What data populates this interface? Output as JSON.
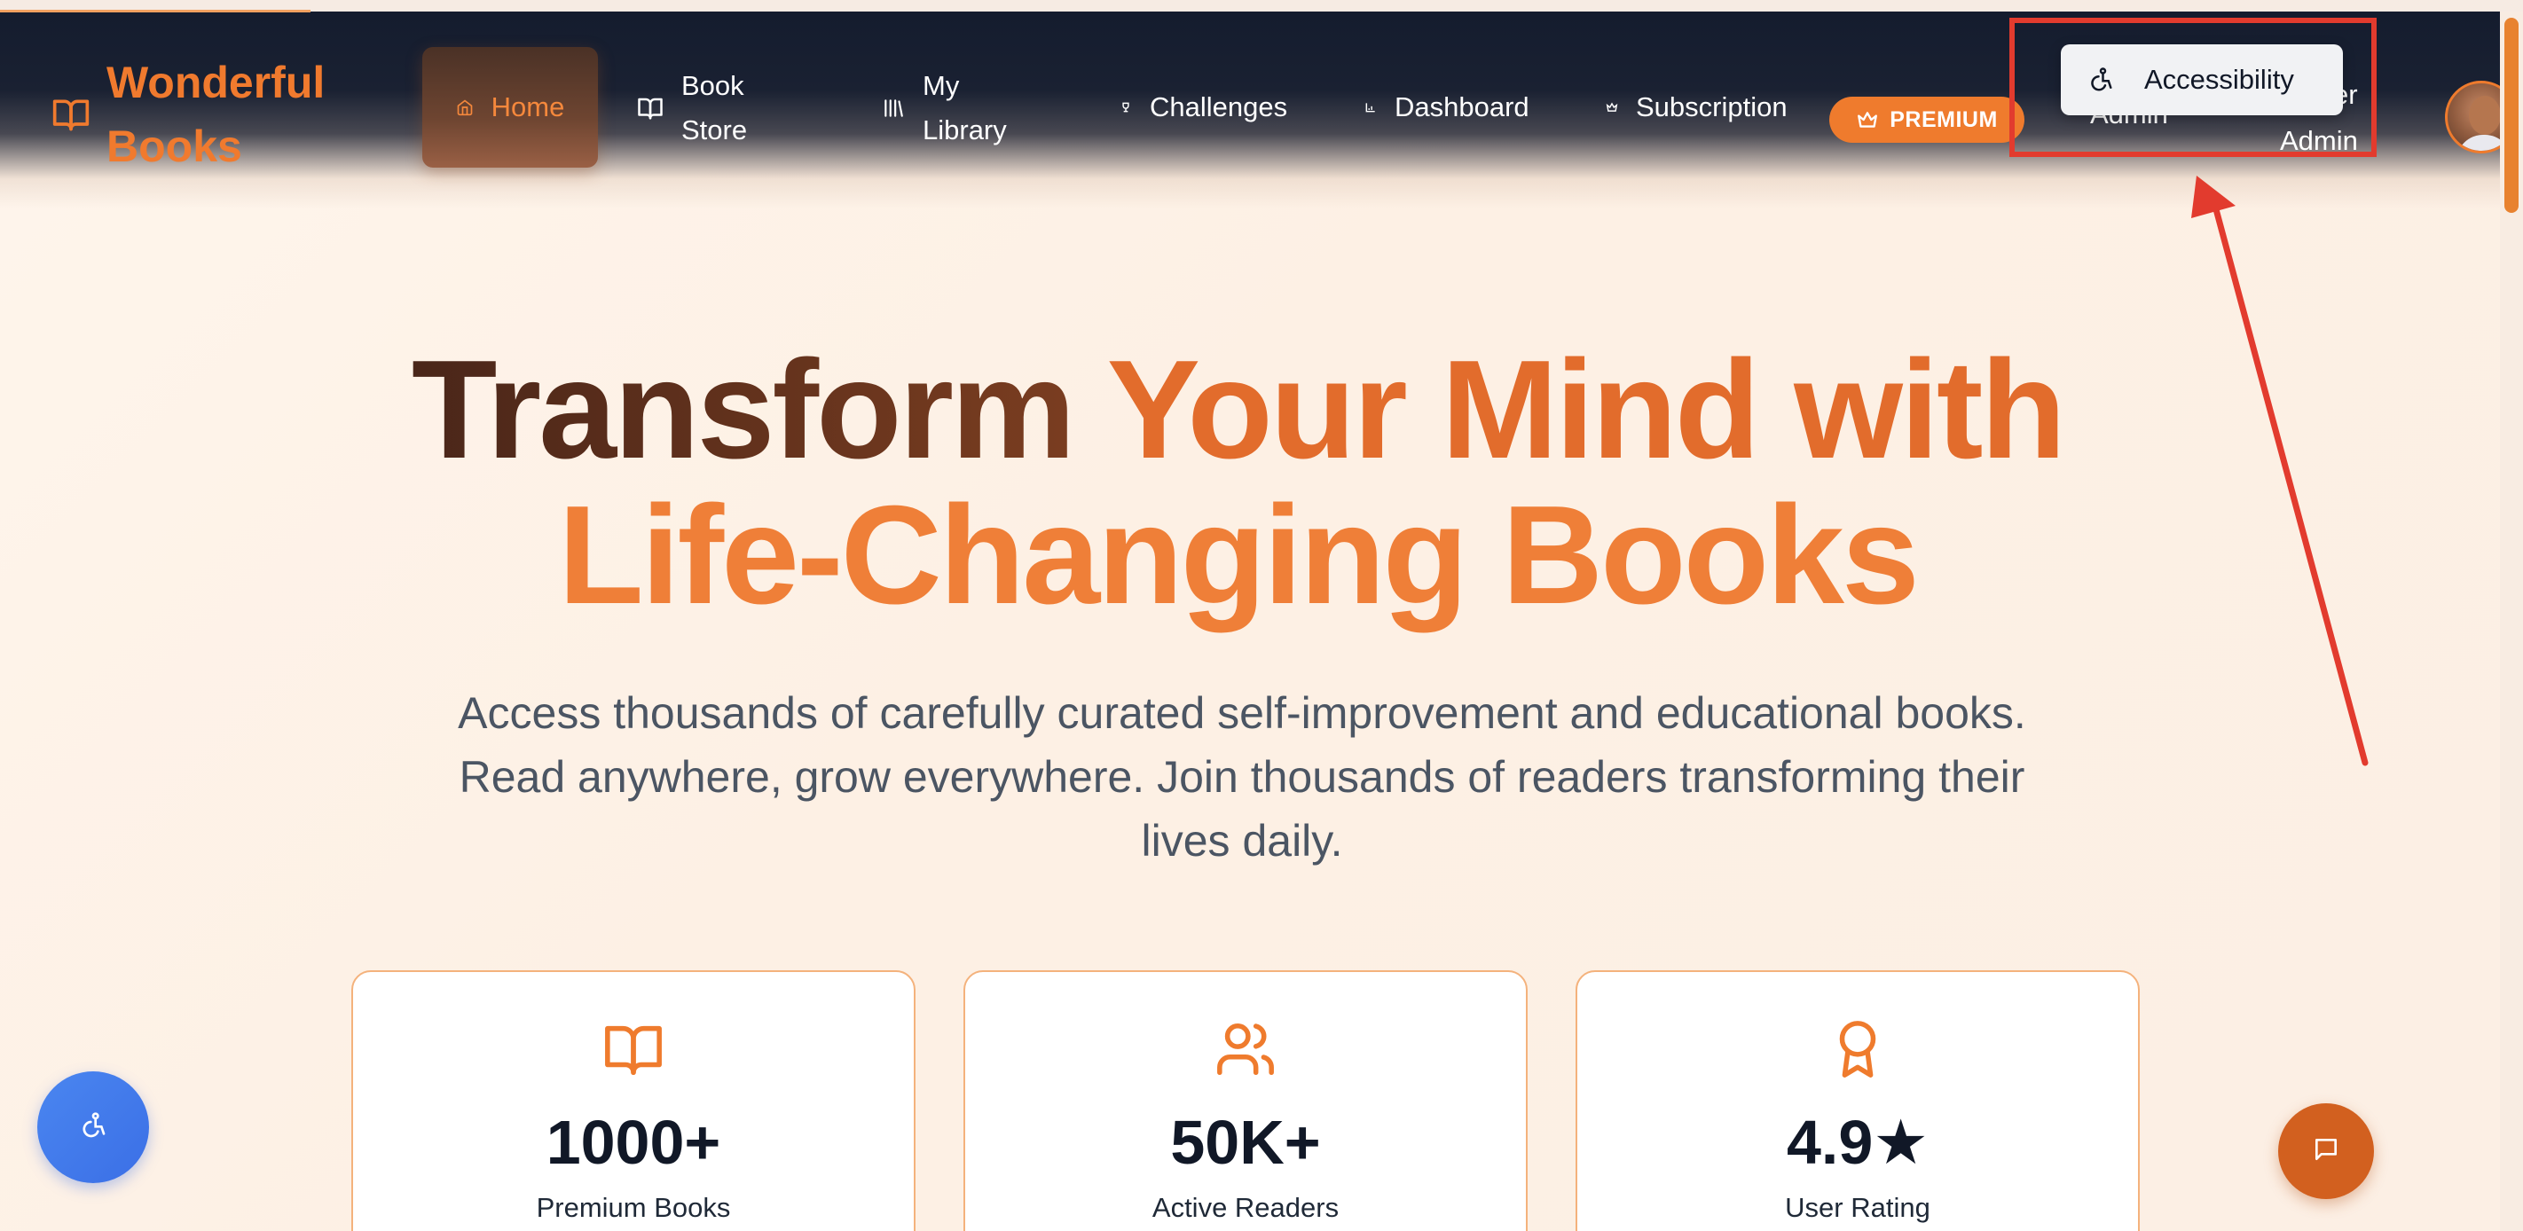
{
  "brand": {
    "name_line1": "Wonderful",
    "name_line2": "Books",
    "icon": "book-open-icon"
  },
  "nav": {
    "home": "Home",
    "book_store_1": "Book",
    "book_store_2": "Store",
    "my_library_1": "My",
    "my_library_2": "Library",
    "challenges": "Challenges",
    "dashboard": "Dashboard",
    "subscription": "Subscription",
    "premium": "PREMIUM"
  },
  "user": {
    "left_fragment": "Admin",
    "right_fragment": "er",
    "name": "Admin"
  },
  "tooltip": {
    "label": "Accessibility",
    "icon": "accessibility-icon"
  },
  "hero": {
    "title_part1": "Transform",
    "title_part2": "Your Mind with",
    "title_line2": "Life-Changing Books",
    "subtitle": "Access thousands of carefully curated self-improvement and educational books. Read anywhere, grow everywhere. Join thousands of readers transforming their lives daily."
  },
  "stats": [
    {
      "value": "1000+",
      "label": "Premium Books",
      "icon": "book-open-icon"
    },
    {
      "value": "50K+",
      "label": "Active Readers",
      "icon": "users-icon"
    },
    {
      "value": "4.9★",
      "label": "User Rating",
      "icon": "award-icon"
    }
  ],
  "colors": {
    "accent": "#ef7b2d",
    "nav_bg": "#141c2e",
    "annotation_red": "#e23b2e",
    "fab_blue": "#3b6fe6",
    "chat_orange": "#d2601f"
  }
}
